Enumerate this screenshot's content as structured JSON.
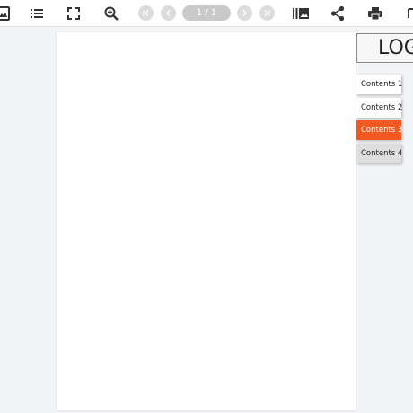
{
  "toolbar": {
    "icons": [
      "thumbnails-icon",
      "list-icon",
      "fullscreen-icon",
      "zoom-in-icon",
      "first-page-icon",
      "prev-page-icon",
      "next-page-icon",
      "last-page-icon",
      "bookshelf-icon",
      "share-icon",
      "print-icon"
    ],
    "page_counter": "1 / 1"
  },
  "sidebar": {
    "logo": "LOGO",
    "tabs": [
      {
        "label": "Contents 1"
      },
      {
        "label": "Contents 2"
      },
      {
        "label": "Contents 3"
      },
      {
        "label": "Contents 4"
      }
    ],
    "active_tab": "Contents 3"
  },
  "colors": {
    "accent": "#f05a22",
    "toolbar_icon": "#333333",
    "background": "#f3f4f6"
  }
}
